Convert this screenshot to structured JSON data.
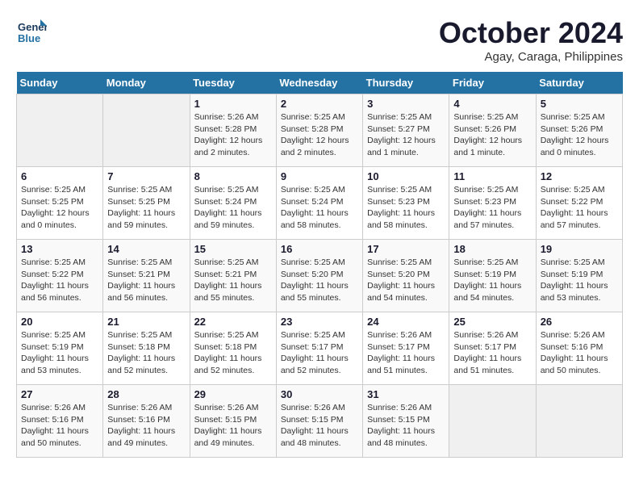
{
  "logo": {
    "line1": "General",
    "line2": "Blue"
  },
  "title": "October 2024",
  "subtitle": "Agay, Caraga, Philippines",
  "days_of_week": [
    "Sunday",
    "Monday",
    "Tuesday",
    "Wednesday",
    "Thursday",
    "Friday",
    "Saturday"
  ],
  "weeks": [
    [
      {
        "day": "",
        "detail": ""
      },
      {
        "day": "",
        "detail": ""
      },
      {
        "day": "1",
        "detail": "Sunrise: 5:26 AM\nSunset: 5:28 PM\nDaylight: 12 hours and 2 minutes."
      },
      {
        "day": "2",
        "detail": "Sunrise: 5:25 AM\nSunset: 5:28 PM\nDaylight: 12 hours and 2 minutes."
      },
      {
        "day": "3",
        "detail": "Sunrise: 5:25 AM\nSunset: 5:27 PM\nDaylight: 12 hours and 1 minute."
      },
      {
        "day": "4",
        "detail": "Sunrise: 5:25 AM\nSunset: 5:26 PM\nDaylight: 12 hours and 1 minute."
      },
      {
        "day": "5",
        "detail": "Sunrise: 5:25 AM\nSunset: 5:26 PM\nDaylight: 12 hours and 0 minutes."
      }
    ],
    [
      {
        "day": "6",
        "detail": "Sunrise: 5:25 AM\nSunset: 5:25 PM\nDaylight: 12 hours and 0 minutes."
      },
      {
        "day": "7",
        "detail": "Sunrise: 5:25 AM\nSunset: 5:25 PM\nDaylight: 11 hours and 59 minutes."
      },
      {
        "day": "8",
        "detail": "Sunrise: 5:25 AM\nSunset: 5:24 PM\nDaylight: 11 hours and 59 minutes."
      },
      {
        "day": "9",
        "detail": "Sunrise: 5:25 AM\nSunset: 5:24 PM\nDaylight: 11 hours and 58 minutes."
      },
      {
        "day": "10",
        "detail": "Sunrise: 5:25 AM\nSunset: 5:23 PM\nDaylight: 11 hours and 58 minutes."
      },
      {
        "day": "11",
        "detail": "Sunrise: 5:25 AM\nSunset: 5:23 PM\nDaylight: 11 hours and 57 minutes."
      },
      {
        "day": "12",
        "detail": "Sunrise: 5:25 AM\nSunset: 5:22 PM\nDaylight: 11 hours and 57 minutes."
      }
    ],
    [
      {
        "day": "13",
        "detail": "Sunrise: 5:25 AM\nSunset: 5:22 PM\nDaylight: 11 hours and 56 minutes."
      },
      {
        "day": "14",
        "detail": "Sunrise: 5:25 AM\nSunset: 5:21 PM\nDaylight: 11 hours and 56 minutes."
      },
      {
        "day": "15",
        "detail": "Sunrise: 5:25 AM\nSunset: 5:21 PM\nDaylight: 11 hours and 55 minutes."
      },
      {
        "day": "16",
        "detail": "Sunrise: 5:25 AM\nSunset: 5:20 PM\nDaylight: 11 hours and 55 minutes."
      },
      {
        "day": "17",
        "detail": "Sunrise: 5:25 AM\nSunset: 5:20 PM\nDaylight: 11 hours and 54 minutes."
      },
      {
        "day": "18",
        "detail": "Sunrise: 5:25 AM\nSunset: 5:19 PM\nDaylight: 11 hours and 54 minutes."
      },
      {
        "day": "19",
        "detail": "Sunrise: 5:25 AM\nSunset: 5:19 PM\nDaylight: 11 hours and 53 minutes."
      }
    ],
    [
      {
        "day": "20",
        "detail": "Sunrise: 5:25 AM\nSunset: 5:19 PM\nDaylight: 11 hours and 53 minutes."
      },
      {
        "day": "21",
        "detail": "Sunrise: 5:25 AM\nSunset: 5:18 PM\nDaylight: 11 hours and 52 minutes."
      },
      {
        "day": "22",
        "detail": "Sunrise: 5:25 AM\nSunset: 5:18 PM\nDaylight: 11 hours and 52 minutes."
      },
      {
        "day": "23",
        "detail": "Sunrise: 5:25 AM\nSunset: 5:17 PM\nDaylight: 11 hours and 52 minutes."
      },
      {
        "day": "24",
        "detail": "Sunrise: 5:26 AM\nSunset: 5:17 PM\nDaylight: 11 hours and 51 minutes."
      },
      {
        "day": "25",
        "detail": "Sunrise: 5:26 AM\nSunset: 5:17 PM\nDaylight: 11 hours and 51 minutes."
      },
      {
        "day": "26",
        "detail": "Sunrise: 5:26 AM\nSunset: 5:16 PM\nDaylight: 11 hours and 50 minutes."
      }
    ],
    [
      {
        "day": "27",
        "detail": "Sunrise: 5:26 AM\nSunset: 5:16 PM\nDaylight: 11 hours and 50 minutes."
      },
      {
        "day": "28",
        "detail": "Sunrise: 5:26 AM\nSunset: 5:16 PM\nDaylight: 11 hours and 49 minutes."
      },
      {
        "day": "29",
        "detail": "Sunrise: 5:26 AM\nSunset: 5:15 PM\nDaylight: 11 hours and 49 minutes."
      },
      {
        "day": "30",
        "detail": "Sunrise: 5:26 AM\nSunset: 5:15 PM\nDaylight: 11 hours and 48 minutes."
      },
      {
        "day": "31",
        "detail": "Sunrise: 5:26 AM\nSunset: 5:15 PM\nDaylight: 11 hours and 48 minutes."
      },
      {
        "day": "",
        "detail": ""
      },
      {
        "day": "",
        "detail": ""
      }
    ]
  ]
}
